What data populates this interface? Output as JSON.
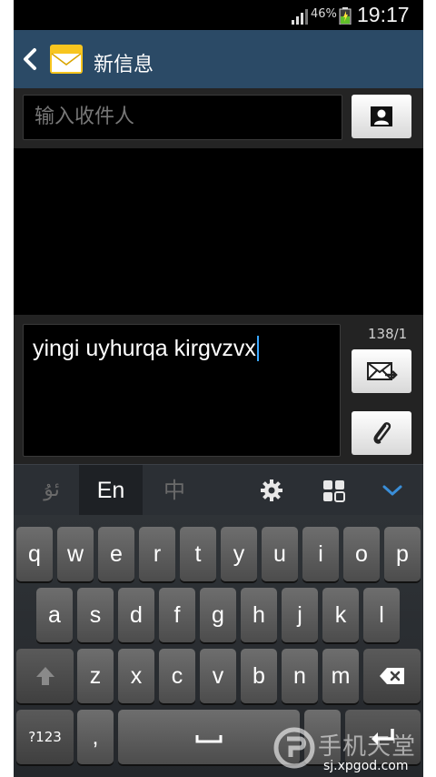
{
  "status_bar": {
    "battery_percent": "46%",
    "time": "19:17"
  },
  "action_bar": {
    "title": "新信息",
    "back_icon": "chevron-left-icon",
    "app_icon": "envelope-icon"
  },
  "recipient": {
    "placeholder": "输入收件人",
    "contact_button_icon": "contact-icon"
  },
  "compose": {
    "text": "yingi uyhurqa kirgvzvx",
    "counter": "138/1",
    "send_icon": "send-message-icon",
    "attach_icon": "paperclip-icon"
  },
  "keyboard_toolbar": {
    "tabs": [
      "ئۇ",
      "En",
      "中"
    ],
    "active_tab": "En",
    "icons": [
      "gear-icon",
      "grid-icon",
      "chevron-down-icon"
    ],
    "accent_color": "#3a8ed8"
  },
  "keyboard": {
    "row1": [
      "q",
      "w",
      "e",
      "r",
      "t",
      "y",
      "u",
      "i",
      "o",
      "p"
    ],
    "row2": [
      "a",
      "s",
      "d",
      "f",
      "g",
      "h",
      "j",
      "k",
      "l"
    ],
    "row3": [
      "z",
      "x",
      "c",
      "v",
      "b",
      "n",
      "m"
    ],
    "shift_icon": "shift-icon",
    "backspace_icon": "backspace-icon",
    "symbols_label": "?123",
    "comma_label": ",",
    "space_icon": "space-icon",
    "enter_icon": "enter-icon"
  },
  "watermark": {
    "title": "手机天堂",
    "url": "sj.xpgod.com"
  }
}
